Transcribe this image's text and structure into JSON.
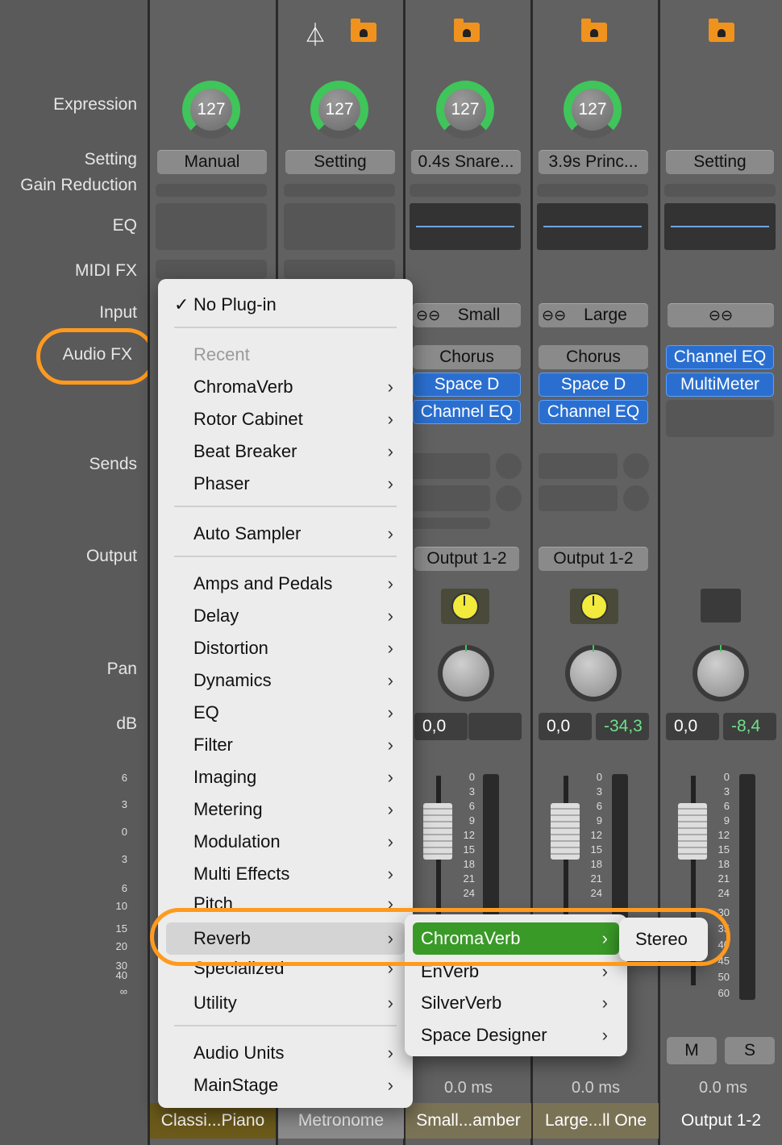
{
  "labels": {
    "expression": "Expression",
    "setting": "Setting",
    "gain_reduction": "Gain Reduction",
    "eq": "EQ",
    "midi_fx": "MIDI FX",
    "input": "Input",
    "audio_fx": "Audio FX",
    "sends": "Sends",
    "output": "Output",
    "pan": "Pan",
    "db": "dB"
  },
  "left_scale": [
    "6",
    "3",
    "0",
    "3",
    "6",
    "10",
    "15",
    "20",
    "30",
    "40",
    "∞"
  ],
  "meter_scale": [
    "0",
    "3",
    "6",
    "9",
    "12",
    "15",
    "18",
    "21",
    "24"
  ],
  "right_scale": [
    "0",
    "3",
    "6",
    "9",
    "12",
    "15",
    "18",
    "21",
    "24",
    "30",
    "35",
    "40",
    "45",
    "50",
    "60"
  ],
  "strips": [
    {
      "name": "Classi...Piano",
      "expression": "127",
      "setting": "Manual",
      "name_bg": "#6b5a1a"
    },
    {
      "name": "Metronome",
      "expression": "127",
      "setting": "Setting",
      "name_bg": "#8a8a8a"
    },
    {
      "name": "Small...amber",
      "expression": "127",
      "setting": "0.4s Snare...",
      "input": "Small",
      "fx": [
        "Chorus",
        "Space D",
        "Channel EQ"
      ],
      "output": "Output 1-2",
      "db": "0,0",
      "latency": "0.0 ms",
      "name_bg": "#7a7255"
    },
    {
      "name": "Large...ll One",
      "expression": "127",
      "setting": "3.9s Princ...",
      "input": "Large",
      "fx": [
        "Chorus",
        "Space D",
        "Channel EQ"
      ],
      "output": "Output 1-2",
      "db": "0,0",
      "db_peak": "-34,3",
      "latency": "0.0 ms",
      "name_bg": "#7a7255"
    },
    {
      "name": "Output 1-2",
      "setting": "Setting",
      "fx": [
        "Channel EQ",
        "MultiMeter"
      ],
      "db": "0,0",
      "db_peak": "-8,4",
      "latency": "0.0 ms",
      "mute": "M",
      "solo": "S",
      "name_bg": "#5f5f5f"
    }
  ],
  "menu": {
    "check": "✓",
    "no_plugin": "No Plug-in",
    "recent_header": "Recent",
    "recent": [
      "ChromaVerb",
      "Rotor Cabinet",
      "Beat Breaker",
      "Phaser"
    ],
    "auto_sampler": "Auto Sampler",
    "categories": [
      "Amps and Pedals",
      "Delay",
      "Distortion",
      "Dynamics",
      "EQ",
      "Filter",
      "Imaging",
      "Metering",
      "Modulation",
      "Multi Effects",
      "Pitch",
      "Reverb",
      "Specialized",
      "Utility"
    ],
    "more": [
      "Audio Units",
      "MainStage"
    ],
    "chevron": "›"
  },
  "submenu": {
    "items": [
      "ChromaVerb",
      "EnVerb",
      "SilverVerb",
      "Space Designer"
    ]
  },
  "submenu2": {
    "items": [
      "Stereo"
    ]
  },
  "colors": {
    "accent_orange": "#ff9a1f",
    "highlight_green": "#3a9a28",
    "knob_green": "#3fc55a"
  }
}
